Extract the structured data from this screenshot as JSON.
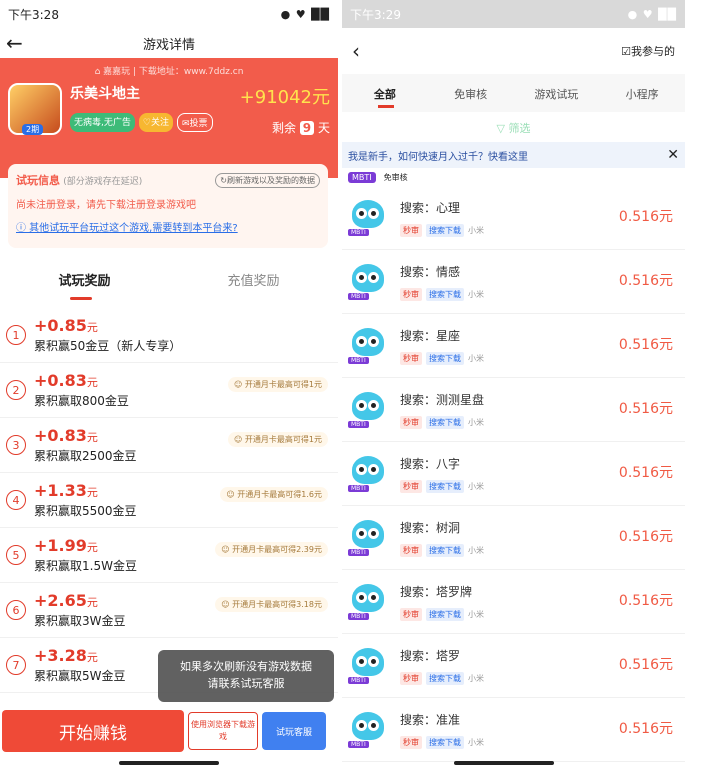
{
  "left": {
    "status": {
      "time": "下午3:28",
      "icons": "● ♥ ██"
    },
    "nav": {
      "back": "←",
      "title": "游戏详情"
    },
    "hero": {
      "site": "⌂ 嘉嘉玩 | 下载地址：www.7ddz.cn",
      "app_name": "乐美斗地主",
      "level_badge": "2期",
      "tags": [
        "无病毒,无广告",
        "♡关注",
        "✉投票"
      ],
      "reward": "+91042元",
      "remain_prefix": "剩余",
      "remain_days": "9",
      "remain_suffix": "天"
    },
    "info": {
      "title": "试玩信息",
      "hint": "(部分游戏存在延迟)",
      "refresh": "↻刷新游戏以及奖励的数据",
      "warning": "尚未注册登录，请先下载注册登录游戏吧",
      "link": "ⓘ 其他试玩平台玩过这个游戏,需要转到本平台来?"
    },
    "tabs": [
      "试玩奖励",
      "充值奖励"
    ],
    "rewards": [
      {
        "num": "1",
        "amount": "+0.85",
        "unit": "元",
        "desc": "累积赢50金豆（新人专享）",
        "pass": ""
      },
      {
        "num": "2",
        "amount": "+0.83",
        "unit": "元",
        "desc": "累积赢取800金豆",
        "pass": "☺ 开通月卡最高可得1元"
      },
      {
        "num": "3",
        "amount": "+0.83",
        "unit": "元",
        "desc": "累积赢取2500金豆",
        "pass": "☺ 开通月卡最高可得1元"
      },
      {
        "num": "4",
        "amount": "+1.33",
        "unit": "元",
        "desc": "累积赢取5500金豆",
        "pass": "☺ 开通月卡最高可得1.6元"
      },
      {
        "num": "5",
        "amount": "+1.99",
        "unit": "元",
        "desc": "累积赢取1.5W金豆",
        "pass": "☺ 开通月卡最高可得2.39元"
      },
      {
        "num": "6",
        "amount": "+2.65",
        "unit": "元",
        "desc": "累积赢取3W金豆",
        "pass": "☺ 开通月卡最高可得3.18元"
      },
      {
        "num": "7",
        "amount": "+3.28",
        "unit": "元",
        "desc": "累积赢取5W金豆",
        "pass": ""
      }
    ],
    "toast": "如果多次刷新没有游戏数据\n请联系试玩客服",
    "bottom": {
      "start": "开始赚钱",
      "browser": "使用浏览器下载游戏",
      "service": "试玩客服"
    }
  },
  "right": {
    "status": {
      "time": "下午3:29",
      "icons": "● ♥ ██"
    },
    "nav": {
      "back": "‹",
      "mine": "☑我参与的"
    },
    "tabs": [
      "全部",
      "免审核",
      "游戏试玩",
      "小程序"
    ],
    "filter": "▽ 筛选",
    "notice": {
      "text": "我是新手，如何快速月入过千？快看这里",
      "close": "✕"
    },
    "peek": {
      "badge": "MBTI",
      "label": "免审核"
    },
    "tasks": [
      {
        "title": "搜索：心理",
        "tag1": "秒审",
        "tag2": "搜索下载",
        "tag3": "小米",
        "price": "0.516元"
      },
      {
        "title": "搜索：情感",
        "tag1": "秒审",
        "tag2": "搜索下载",
        "tag3": "小米",
        "price": "0.516元"
      },
      {
        "title": "搜索：星座",
        "tag1": "秒审",
        "tag2": "搜索下载",
        "tag3": "小米",
        "price": "0.516元"
      },
      {
        "title": "搜索：测测星盘",
        "tag1": "秒审",
        "tag2": "搜索下载",
        "tag3": "小米",
        "price": "0.516元"
      },
      {
        "title": "搜索：八字",
        "tag1": "秒审",
        "tag2": "搜索下载",
        "tag3": "小米",
        "price": "0.516元"
      },
      {
        "title": "搜索：树洞",
        "tag1": "秒审",
        "tag2": "搜索下载",
        "tag3": "小米",
        "price": "0.516元"
      },
      {
        "title": "搜索：塔罗牌",
        "tag1": "秒审",
        "tag2": "搜索下载",
        "tag3": "小米",
        "price": "0.516元"
      },
      {
        "title": "搜索：塔罗",
        "tag1": "秒审",
        "tag2": "搜索下载",
        "tag3": "小米",
        "price": "0.516元"
      },
      {
        "title": "搜索：准准",
        "tag1": "秒审",
        "tag2": "搜索下载",
        "tag3": "小米",
        "price": "0.516元"
      }
    ],
    "owl_badge": "MBTI"
  }
}
